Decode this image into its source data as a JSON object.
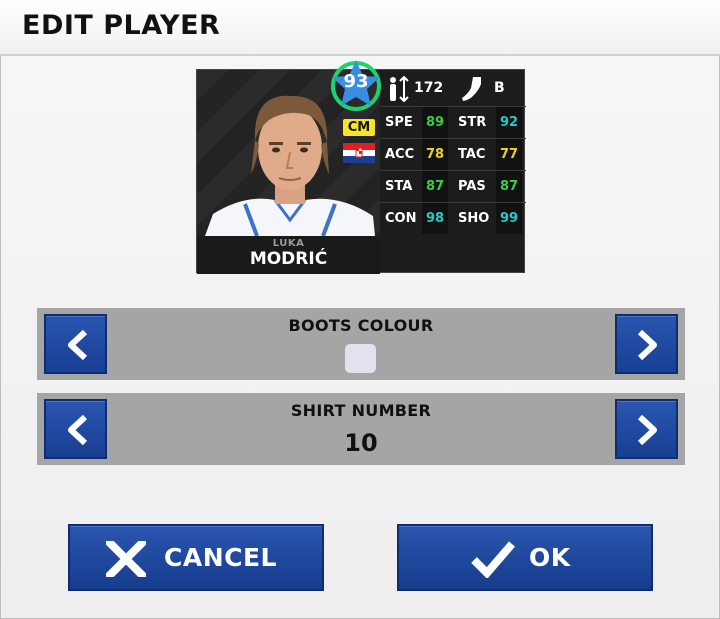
{
  "screen": {
    "title": "EDIT PLAYER"
  },
  "player": {
    "first_name": "LUKA",
    "last_name": "MODRIĆ",
    "rating": "93",
    "position": "CM",
    "nationality_flag": "croatia",
    "height": "172",
    "preferred_foot": "B",
    "stats": [
      {
        "label": "SPE",
        "value": "89",
        "color": "#35d047"
      },
      {
        "label": "STR",
        "value": "92",
        "color": "#29c9c9"
      },
      {
        "label": "ACC",
        "value": "78",
        "color": "#f2d21a"
      },
      {
        "label": "TAC",
        "value": "77",
        "color": "#f2d21a"
      },
      {
        "label": "STA",
        "value": "87",
        "color": "#35d047"
      },
      {
        "label": "PAS",
        "value": "87",
        "color": "#35d047"
      },
      {
        "label": "CON",
        "value": "98",
        "color": "#29c9c9"
      },
      {
        "label": "SHO",
        "value": "99",
        "color": "#29c9c9"
      }
    ]
  },
  "boots_colour": {
    "title": "BOOTS COLOUR",
    "swatch_color": "#e4e1ee"
  },
  "shirt_number": {
    "title": "SHIRT NUMBER",
    "value": "10"
  },
  "buttons": {
    "cancel": "CANCEL",
    "ok": "OK"
  },
  "colors": {
    "button_blue": "#2a56b0",
    "panel_grey": "#a5a5a5",
    "rating_star": "#3a8de0"
  }
}
